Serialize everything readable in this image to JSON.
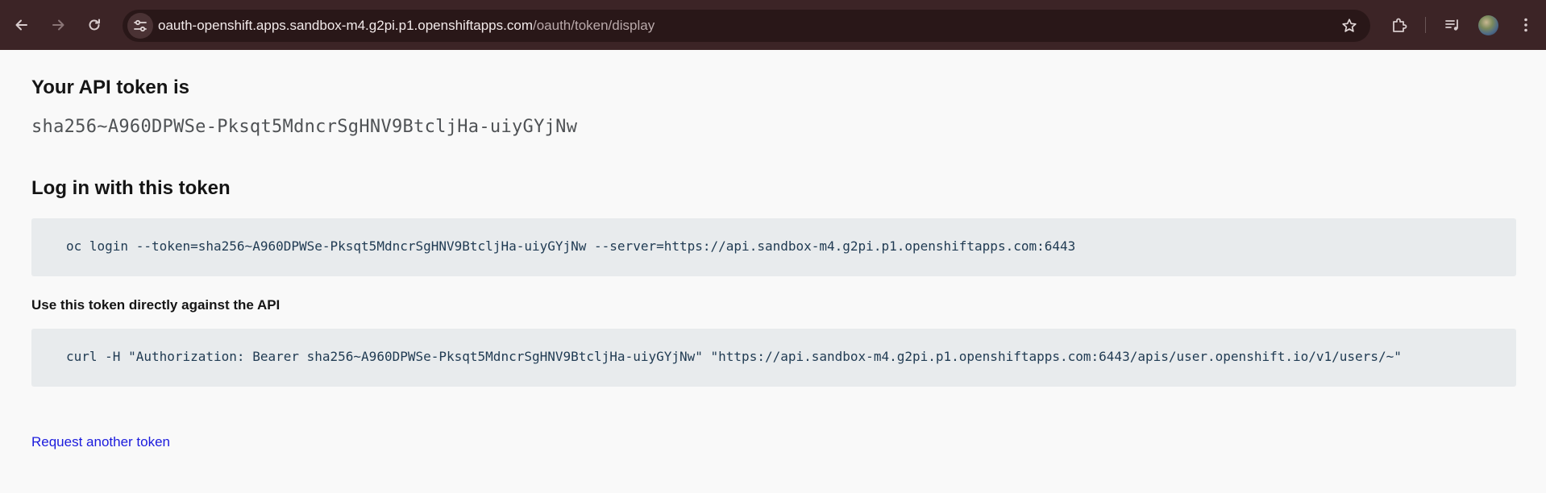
{
  "browser": {
    "url_host": "oauth-openshift.apps.sandbox-m4.g2pi.p1.openshiftapps.com",
    "url_path": "/oauth/token/display",
    "icons": {
      "back": "back-arrow-icon",
      "forward": "forward-arrow-icon",
      "reload": "reload-icon",
      "site_info": "tune-icon",
      "bookmark": "star-icon",
      "extensions": "puzzle-icon",
      "media": "media-queue-icon",
      "profile": "avatar",
      "menu": "kebab-menu-icon"
    },
    "colors": {
      "frame": "#3c2426",
      "omnibox": "#291718"
    }
  },
  "page": {
    "heading_token": "Your API token is",
    "token": "sha256~A960DPWSe-Pksqt5MdncrSgHNV9BtcljHa-uiyGYjNw",
    "heading_login": "Log in with this token",
    "login_command": "oc login --token=sha256~A960DPWSe-Pksqt5MdncrSgHNV9BtcljHa-uiyGYjNw --server=https://api.sandbox-m4.g2pi.p1.openshiftapps.com:6443",
    "heading_api": "Use this token directly against the API",
    "curl_command": "curl -H \"Authorization: Bearer sha256~A960DPWSe-Pksqt5MdncrSgHNV9BtcljHa-uiyGYjNw\" \"https://api.sandbox-m4.g2pi.p1.openshiftapps.com:6443/apis/user.openshift.io/v1/users/~\"",
    "request_link": "Request another token",
    "colors": {
      "link": "#1b1bdd",
      "code_bg": "#e8ebed",
      "code_text": "#1f3a52"
    }
  }
}
